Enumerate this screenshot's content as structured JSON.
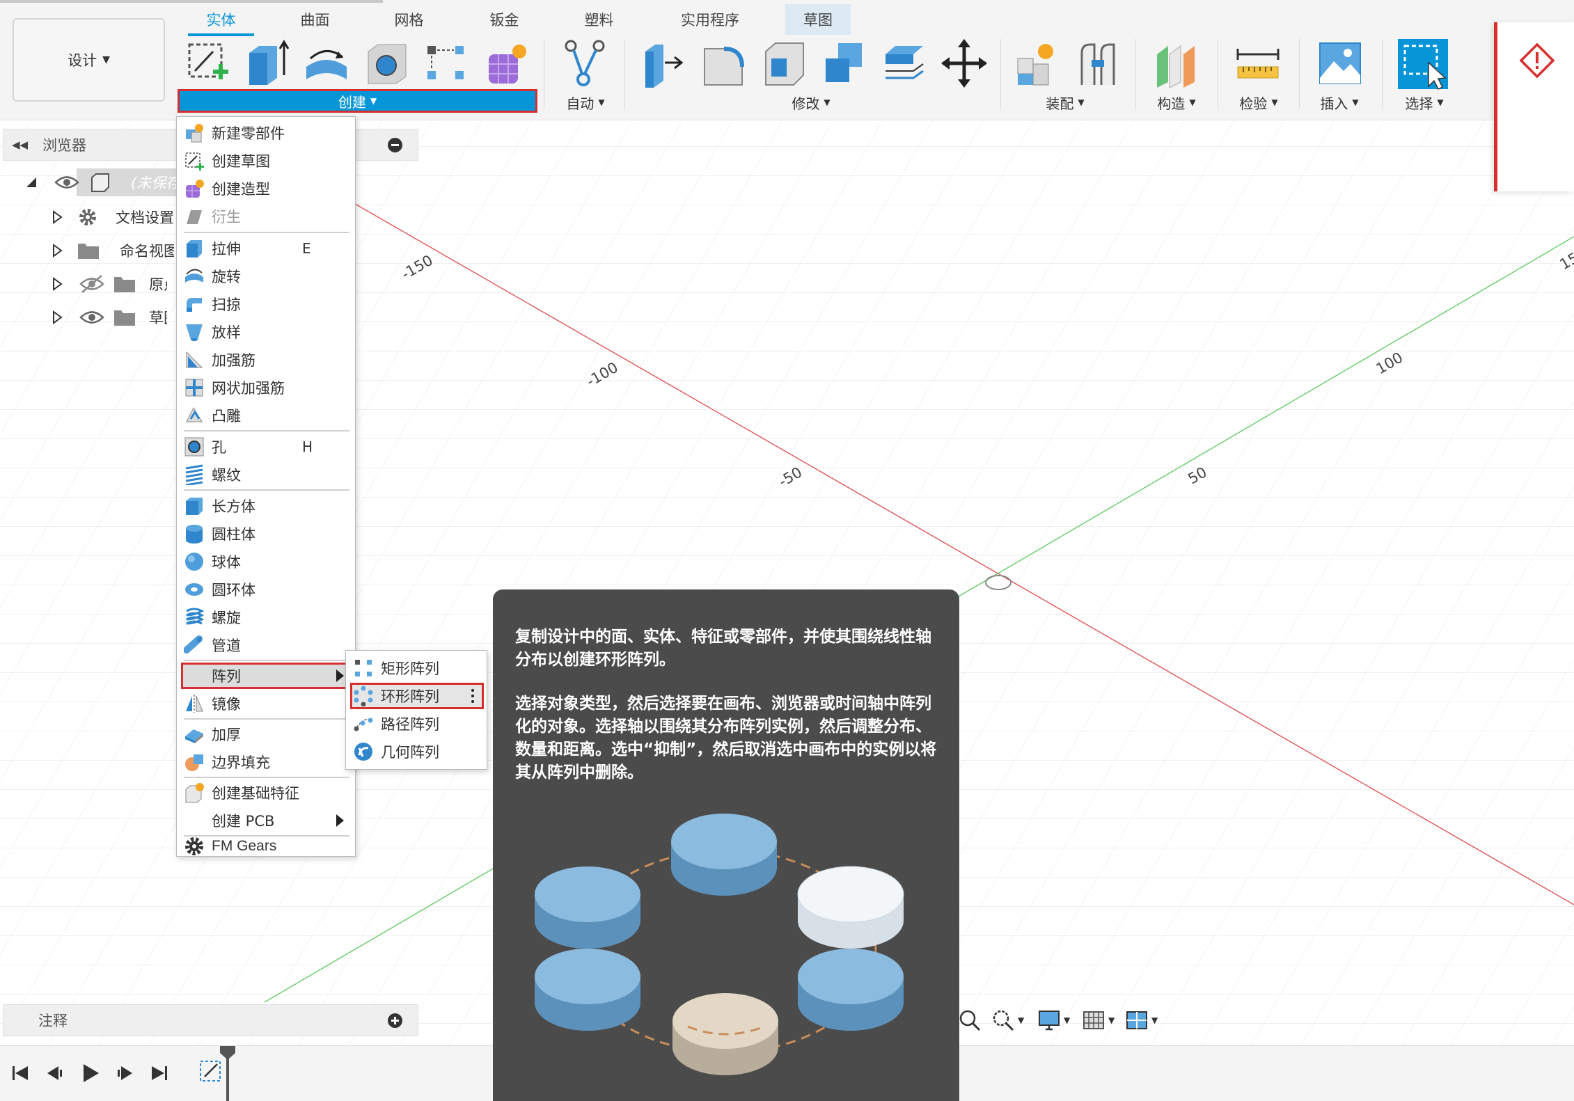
{
  "toolbar": {
    "design_label": "设计",
    "tabs": [
      "实体",
      "曲面",
      "网格",
      "钣金",
      "塑料",
      "实用程序",
      "草图"
    ],
    "groups": {
      "create": "创建",
      "automate": "自动",
      "modify": "修改",
      "assemble": "装配",
      "construct": "构造",
      "inspect": "检验",
      "insert": "插入",
      "select": "选择"
    }
  },
  "browser": {
    "title": "浏览器",
    "items": [
      {
        "label": "(未保存)"
      },
      {
        "label": "文档设置"
      },
      {
        "label": "命名视图"
      },
      {
        "label": "原点"
      },
      {
        "label": "草图"
      }
    ]
  },
  "notes": {
    "title": "注释"
  },
  "canvas": {
    "axis_labels": [
      "-150",
      "-100",
      "-50",
      "50",
      "100",
      "15"
    ]
  },
  "create_menu": {
    "items": [
      {
        "label": "新建零部件",
        "icon": "new-component-icon"
      },
      {
        "label": "创建草图",
        "icon": "create-sketch-icon"
      },
      {
        "label": "创建造型",
        "icon": "create-form-icon"
      },
      {
        "label": "衍生",
        "icon": "derive-icon",
        "disabled": true
      },
      {
        "label": "拉伸",
        "shortcut": "E",
        "icon": "extrude-icon"
      },
      {
        "label": "旋转",
        "icon": "revolve-icon"
      },
      {
        "label": "扫掠",
        "icon": "sweep-icon"
      },
      {
        "label": "放样",
        "icon": "loft-icon"
      },
      {
        "label": "加强筋",
        "icon": "rib-icon"
      },
      {
        "label": "网状加强筋",
        "icon": "web-icon"
      },
      {
        "label": "凸雕",
        "icon": "emboss-icon"
      },
      {
        "label": "孔",
        "shortcut": "H",
        "icon": "hole-icon"
      },
      {
        "label": "螺纹",
        "icon": "thread-icon"
      },
      {
        "label": "长方体",
        "icon": "box-icon"
      },
      {
        "label": "圆柱体",
        "icon": "cylinder-icon"
      },
      {
        "label": "球体",
        "icon": "sphere-icon"
      },
      {
        "label": "圆环体",
        "icon": "torus-icon"
      },
      {
        "label": "螺旋",
        "icon": "coil-icon"
      },
      {
        "label": "管道",
        "icon": "pipe-icon"
      },
      {
        "label": "阵列",
        "icon": "pattern-icon"
      },
      {
        "label": "镜像",
        "icon": "mirror-icon"
      },
      {
        "label": "加厚",
        "icon": "thicken-icon"
      },
      {
        "label": "边界填充",
        "icon": "boundary-fill-icon"
      },
      {
        "label": "创建基础特征",
        "icon": "base-feature-icon"
      },
      {
        "label": "创建 PCB",
        "icon": ""
      },
      {
        "label": "FM Gears",
        "icon": "gear-icon"
      }
    ]
  },
  "pattern_submenu": {
    "items": [
      {
        "label": "矩形阵列",
        "icon": "rectangular-pattern-icon"
      },
      {
        "label": "环形阵列",
        "icon": "circular-pattern-icon"
      },
      {
        "label": "路径阵列",
        "icon": "path-pattern-icon"
      },
      {
        "label": "几何阵列",
        "icon": "geometric-pattern-icon"
      }
    ]
  },
  "tooltip": {
    "text1": "复制设计中的面、实体、特征或零部件，并使其围绕线性轴分布以创建环形阵列。",
    "text2": "选择对象类型，然后选择要在画布、浏览器或时间轴中阵列化的对象。选择轴以围绕其分布阵列实例，然后调整分布、数量和距离。选中“抑制”，然后取消选中画布中的实例以将其从阵列中删除。"
  },
  "colors": {
    "accent": "#0696d7",
    "highlight_border": "#d72e2e",
    "tooltip_bg": "#4b4b4b",
    "x_axis": "#e05555",
    "y_axis": "#66cc66"
  }
}
